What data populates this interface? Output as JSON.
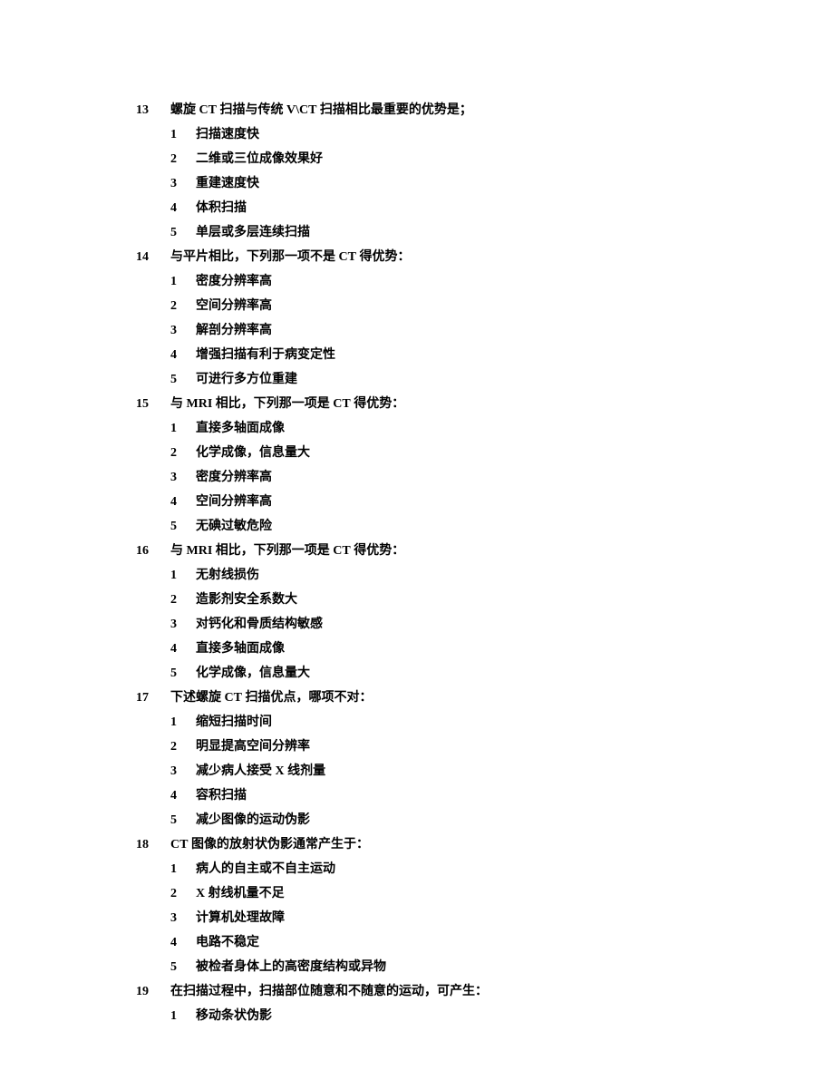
{
  "questions": [
    {
      "num": "13",
      "text": "螺旋 CT 扫描与传统 V\\CT 扫描相比最重要的优势是；",
      "options": [
        {
          "num": "1",
          "text": "扫描速度快"
        },
        {
          "num": "2",
          "text": "二维或三位成像效果好"
        },
        {
          "num": "3",
          "text": "重建速度快"
        },
        {
          "num": "4",
          "text": "体积扫描"
        },
        {
          "num": "5",
          "text": "单层或多层连续扫描"
        }
      ]
    },
    {
      "num": "14",
      "text": "与平片相比，下列那一项不是 CT 得优势：",
      "options": [
        {
          "num": "1",
          "text": "密度分辨率高"
        },
        {
          "num": "2",
          "text": "空间分辨率高"
        },
        {
          "num": "3",
          "text": "解剖分辨率高"
        },
        {
          "num": "4",
          "text": "增强扫描有利于病变定性"
        },
        {
          "num": "5",
          "text": "可进行多方位重建"
        }
      ]
    },
    {
      "num": "15",
      "text": "与 MRI 相比，下列那一项是 CT 得优势：",
      "options": [
        {
          "num": "1",
          "text": "直接多轴面成像"
        },
        {
          "num": "2",
          "text": "化学成像，信息量大"
        },
        {
          "num": "3",
          "text": "密度分辨率高"
        },
        {
          "num": "4",
          "text": "空间分辨率高"
        },
        {
          "num": "5",
          "text": "无碘过敏危险"
        }
      ]
    },
    {
      "num": "16",
      "text": "与 MRI 相比，下列那一项是 CT 得优势：",
      "options": [
        {
          "num": "1",
          "text": "无射线损伤"
        },
        {
          "num": "2",
          "text": "造影剂安全系数大"
        },
        {
          "num": "3",
          "text": "对钙化和骨质结构敏感"
        },
        {
          "num": "4",
          "text": "直接多轴面成像"
        },
        {
          "num": "5",
          "text": "化学成像，信息量大"
        }
      ]
    },
    {
      "num": "17",
      "text": "下述螺旋 CT 扫描优点，哪项不对：",
      "options": [
        {
          "num": "1",
          "text": "缩短扫描时间"
        },
        {
          "num": "2",
          "text": "明显提高空间分辨率"
        },
        {
          "num": "3",
          "text": "减少病人接受 X 线剂量"
        },
        {
          "num": "4",
          "text": "容积扫描"
        },
        {
          "num": "5",
          "text": "减少图像的运动伪影"
        }
      ]
    },
    {
      "num": "18",
      "text": "CT 图像的放射状伪影通常产生于：",
      "options": [
        {
          "num": "1",
          "text": "病人的自主或不自主运动"
        },
        {
          "num": "2",
          "text": "X 射线机量不足"
        },
        {
          "num": "3",
          "text": "计算机处理故障"
        },
        {
          "num": "4",
          "text": "电路不稳定"
        },
        {
          "num": "5",
          "text": "被检者身体上的高密度结构或异物"
        }
      ]
    },
    {
      "num": "19",
      "text": "在扫描过程中，扫描部位随意和不随意的运动，可产生：",
      "options": [
        {
          "num": "1",
          "text": "移动条状伪影"
        }
      ]
    }
  ]
}
